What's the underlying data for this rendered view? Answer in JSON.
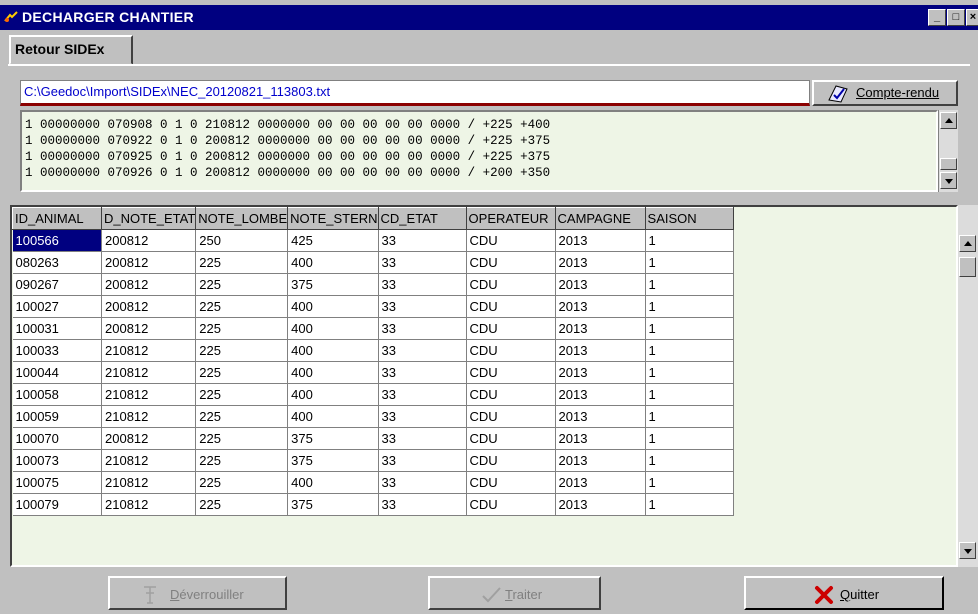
{
  "window": {
    "title": "DECHARGER CHANTIER",
    "min_label": "_",
    "max_label": "□",
    "close_label": "×"
  },
  "tab": {
    "label": "Retour SIDEx"
  },
  "file": {
    "path": "C:\\Geedoc\\Import\\SIDEx\\NEC_20120821_113803.txt",
    "report_button": "Compte-rendu",
    "raw_lines": [
      "1 00000000 070908 0 1 0 210812 0000000 00 00 00 00 00 0000 / +225 +400",
      "1 00000000 070922 0 1 0 200812 0000000 00 00 00 00 00 0000 / +225 +375",
      "1 00000000 070925 0 1 0 200812 0000000 00 00 00 00 00 0000 / +225 +375",
      "1 00000000 070926 0 1 0 200812 0000000 00 00 00 00 00 0000 / +200 +350"
    ]
  },
  "grid": {
    "columns": [
      "ID_ANIMAL",
      "D_NOTE_ETAT",
      "NOTE_LOMBE",
      "NOTE_STERN",
      "CD_ETAT",
      "OPERATEUR",
      "CAMPAGNE",
      "SAISON"
    ],
    "rows": [
      [
        "100566",
        "200812",
        "250",
        "425",
        "33",
        "CDU",
        "2013",
        "1"
      ],
      [
        "080263",
        "200812",
        "225",
        "400",
        "33",
        "CDU",
        "2013",
        "1"
      ],
      [
        "090267",
        "200812",
        "225",
        "375",
        "33",
        "CDU",
        "2013",
        "1"
      ],
      [
        "100027",
        "200812",
        "225",
        "400",
        "33",
        "CDU",
        "2013",
        "1"
      ],
      [
        "100031",
        "200812",
        "225",
        "400",
        "33",
        "CDU",
        "2013",
        "1"
      ],
      [
        "100033",
        "210812",
        "225",
        "400",
        "33",
        "CDU",
        "2013",
        "1"
      ],
      [
        "100044",
        "210812",
        "225",
        "400",
        "33",
        "CDU",
        "2013",
        "1"
      ],
      [
        "100058",
        "210812",
        "225",
        "400",
        "33",
        "CDU",
        "2013",
        "1"
      ],
      [
        "100059",
        "210812",
        "225",
        "400",
        "33",
        "CDU",
        "2013",
        "1"
      ],
      [
        "100070",
        "200812",
        "225",
        "375",
        "33",
        "CDU",
        "2013",
        "1"
      ],
      [
        "100073",
        "210812",
        "225",
        "375",
        "33",
        "CDU",
        "2013",
        "1"
      ],
      [
        "100075",
        "210812",
        "225",
        "400",
        "33",
        "CDU",
        "2013",
        "1"
      ],
      [
        "100079",
        "210812",
        "225",
        "375",
        "33",
        "CDU",
        "2013",
        "1"
      ]
    ],
    "selected_row": 0
  },
  "buttons": {
    "unlock": "Déverrouiller",
    "process": "Traiter",
    "quit": "Quitter"
  },
  "colors": {
    "titlebar": "#000080",
    "panel": "#eef5e6",
    "quit_icon": "#cc0000"
  }
}
